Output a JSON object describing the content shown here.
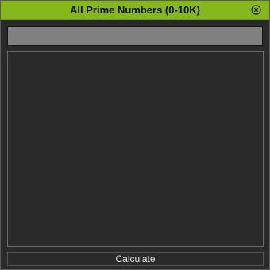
{
  "window": {
    "title": "All Prime Numbers (0-10K)",
    "accent_color": "#86b81c",
    "close_icon": "close-circle-x"
  },
  "input": {
    "value": ""
  },
  "output": {
    "value": ""
  },
  "actions": {
    "calculate_label": "Calculate"
  }
}
